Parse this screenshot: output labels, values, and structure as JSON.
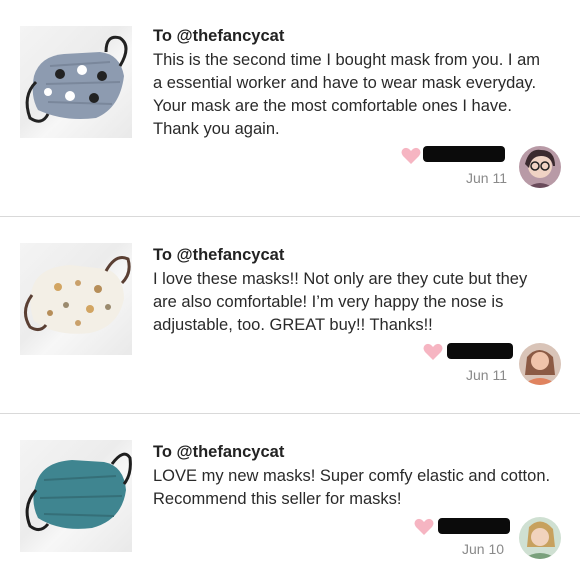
{
  "reviews": [
    {
      "to": "To @thefancycat",
      "text": "This is the second time I bought mask from you. I am a essential worker and have to wear mask everyday. Your mask are the most comfortable ones I have. Thank you again.",
      "date": "Jun 11",
      "thumb_icon": "grey-patterned-mask",
      "avatar_icon": "reviewer-avatar-glasses"
    },
    {
      "to": "To @thefancycat",
      "text": "I love these masks!! Not only are they cute but they are also comfortable! I’m very happy the nose is adjustable, too. GREAT buy!! Thanks!!",
      "date": "Jun 11",
      "thumb_icon": "cream-print-mask",
      "avatar_icon": "reviewer-avatar"
    },
    {
      "to": "To @thefancycat",
      "text": "LOVE my new masks! Super comfy elastic and cotton. Recommend this seller for masks!",
      "date": "Jun 10",
      "thumb_icon": "teal-mask",
      "avatar_icon": "reviewer-avatar"
    }
  ],
  "colors": {
    "heart": "#f6b5c2",
    "divider": "#d9d9d9",
    "date": "#8a8a8a"
  }
}
